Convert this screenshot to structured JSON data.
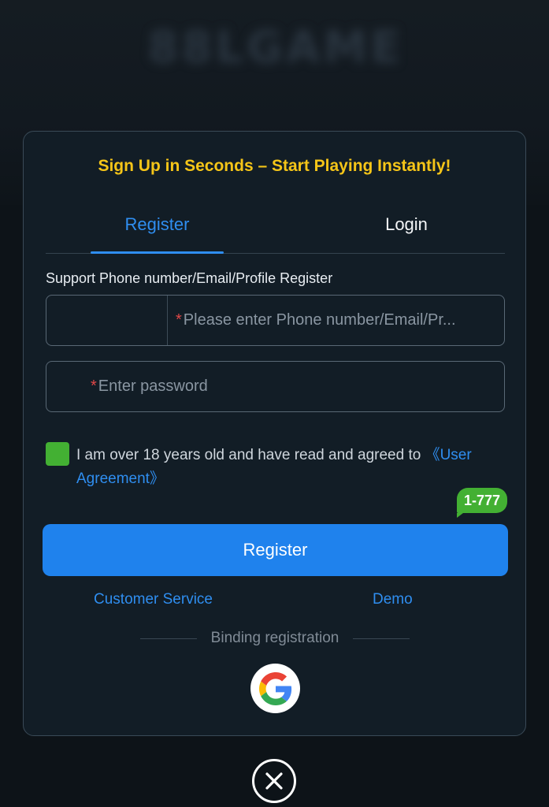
{
  "background": {
    "logo_text": "88LGAME"
  },
  "modal": {
    "headline": "Sign Up in Seconds – Start Playing Instantly!",
    "tabs": [
      {
        "label": "Register",
        "active": true
      },
      {
        "label": "Login",
        "active": false
      }
    ],
    "support_label": "Support Phone number/Email/Profile Register",
    "account_field": {
      "required_mark": "*",
      "placeholder": "Please enter Phone number/Email/Pr..."
    },
    "password_field": {
      "required_mark": "*",
      "placeholder": "Enter password"
    },
    "agreement": {
      "checked": true,
      "text": "I am over 18 years old and have read and agreed to ",
      "link": "《User Agreement》"
    },
    "badge": "1-777",
    "register_button": "Register",
    "links": {
      "customer_service": "Customer Service",
      "demo": "Demo"
    },
    "binding_label": "Binding registration",
    "social": [
      {
        "icon": "google-icon"
      }
    ]
  },
  "close_icon": "close-icon",
  "colors": {
    "accent_blue": "#1f82ed",
    "headline_yellow": "#f5c518",
    "checkbox_green": "#43b033",
    "required_red": "#e04848"
  }
}
